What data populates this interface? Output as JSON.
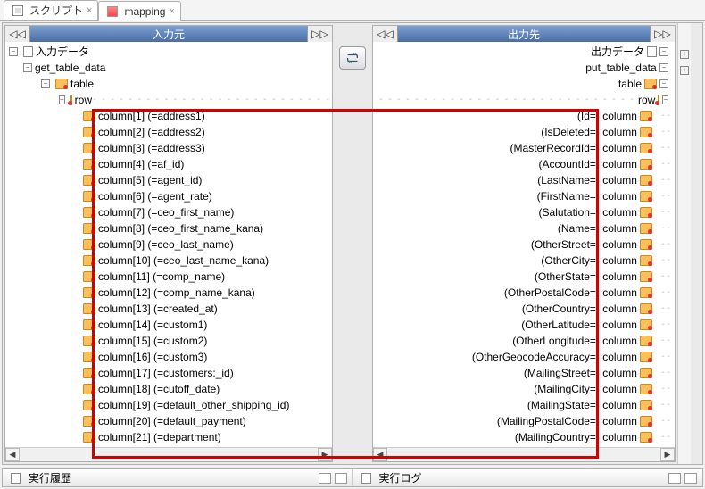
{
  "tabs": {
    "script": "スクリプト",
    "mapping": "mapping"
  },
  "left": {
    "header": "入力元",
    "root": "入力データ",
    "fn": "get_table_data",
    "table": "table",
    "row": "row",
    "cols": [
      "column[1] (=address1)",
      "column[2] (=address2)",
      "column[3] (=address3)",
      "column[4] (=af_id)",
      "column[5] (=agent_id)",
      "column[6] (=agent_rate)",
      "column[7] (=ceo_first_name)",
      "column[8] (=ceo_first_name_kana)",
      "column[9] (=ceo_last_name)",
      "column[10] (=ceo_last_name_kana)",
      "column[11] (=comp_name)",
      "column[12] (=comp_name_kana)",
      "column[13] (=created_at)",
      "column[14] (=custom1)",
      "column[15] (=custom2)",
      "column[16] (=custom3)",
      "column[17] (=customers:_id)",
      "column[18] (=cutoff_date)",
      "column[19] (=default_other_shipping_id)",
      "column[20] (=default_payment)",
      "column[21] (=department)"
    ]
  },
  "right": {
    "header": "出力先",
    "root": "出力データ",
    "fn": "put_table_data",
    "table": "table",
    "row": "row",
    "cols": [
      "(Id=) column",
      "(IsDeleted=) column",
      "(MasterRecordId=) column",
      "(AccountId=) column",
      "(LastName=) column",
      "(FirstName=) column",
      "(Salutation=) column",
      "(Name=) column",
      "(OtherStreet=) column",
      "(OtherCity=) column",
      "(OtherState=) column",
      "(OtherPostalCode=) column",
      "(OtherCountry=) column",
      "(OtherLatitude=) column",
      "(OtherLongitude=) column",
      "(OtherGeocodeAccuracy=) column",
      "(MailingStreet=) column",
      "(MailingCity=) column",
      "(MailingState=) column",
      "(MailingPostalCode=) column",
      "(MailingCountry=) column"
    ]
  },
  "bottom": {
    "history": "実行履歴",
    "log": "実行ログ"
  }
}
